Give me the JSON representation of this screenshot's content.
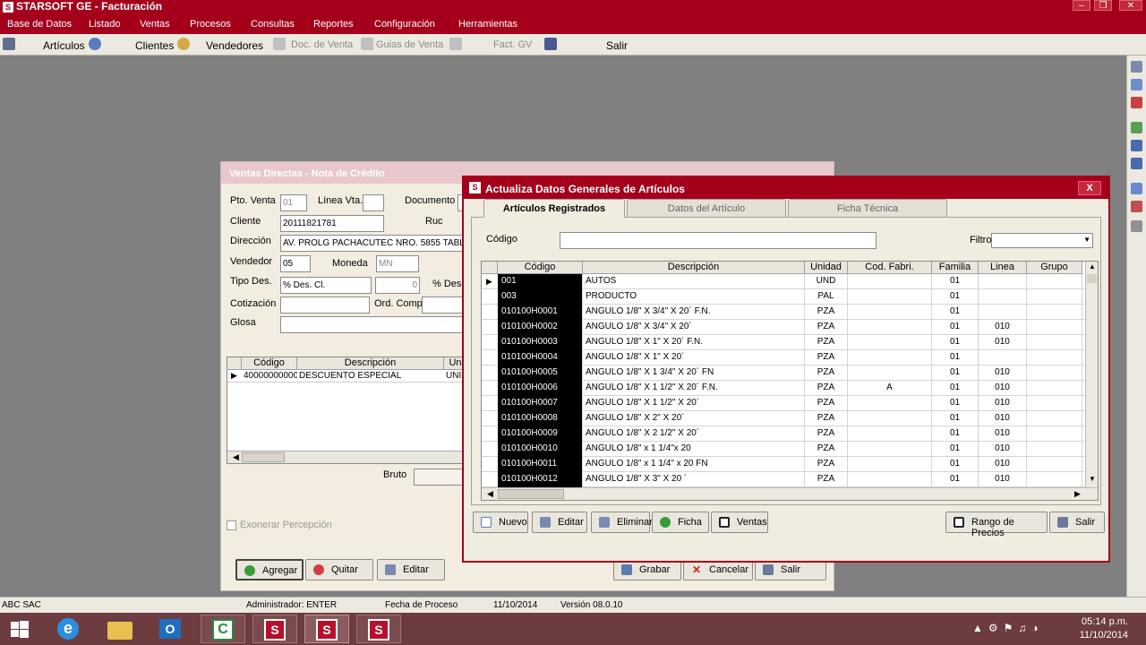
{
  "app": {
    "title": "STARSOFT GE - Facturación"
  },
  "menu": [
    "Base de Datos",
    "Listado",
    "Ventas",
    "Procesos",
    "Consultas",
    "Reportes",
    "Configuración",
    "Herramientas"
  ],
  "toolbar": {
    "articulos": "Artículos",
    "clientes": "Clientes",
    "vendedores": "Vendedores",
    "doc_venta": "Doc. de Venta",
    "guias_venta": "Guias de Venta",
    "fact_gv": "Fact. GV",
    "salir": "Salir"
  },
  "bg_window": {
    "title": "Ventas Directas - Nota de Crédito",
    "pto_venta_label": "Pto. Venta",
    "pto_venta": "01",
    "linea_vta_label": "Línea Vta.",
    "documento_label": "Documento",
    "cliente_label": "Cliente",
    "cliente": "20111821781",
    "ruc_label": "Ruc",
    "direccion_label": "Dirección",
    "direccion": "AV. PROLG PACHACUTEC NRO. 5855 TABL",
    "vendedor_label": "Vendedor",
    "vendedor": "05",
    "moneda_label": "Moneda",
    "moneda": "MN",
    "tipo_des_label": "Tipo Des.",
    "tipo_des": "% Des. Cl.",
    "tipo_des_val": "0",
    "pct_des_label": "% Des.",
    "cotizacion_label": "Cotización",
    "ord_comp_label": "Ord. Comp.",
    "glosa_label": "Glosa",
    "grid": {
      "headers": [
        "Código",
        "Descripción",
        "Un"
      ],
      "row": [
        "400000000002",
        "DESCUENTO ESPECIAL",
        "UNI"
      ]
    },
    "bruto_label": "Bruto",
    "exonerar": "Exonerar Percepción",
    "agregar": "Agregar",
    "quitar": "Quitar",
    "editar": "Editar",
    "grabar": "Grabar",
    "cancelar": "Cancelar",
    "salir": "Salir"
  },
  "modal": {
    "title": "Actualiza Datos Generales de Artículos",
    "close": "X",
    "tabs": [
      "Artículos Registrados",
      "Datos del Artículo",
      "Ficha Técnica"
    ],
    "codigo_label": "Código",
    "filtro_label": "Filtro",
    "columns": [
      "Código",
      "Descripción",
      "Unidad",
      "Cod. Fabri.",
      "Familia",
      "Linea",
      "Grupo"
    ],
    "rows": [
      [
        "001",
        "AUTOS",
        "UND",
        "",
        "01",
        "",
        ""
      ],
      [
        "003",
        "PRODUCTO",
        "PAL",
        "",
        "01",
        "",
        ""
      ],
      [
        "010100H0001",
        "ANGULO 1/8\" X 3/4\" X 20´ F.N.",
        "PZA",
        "",
        "01",
        "",
        ""
      ],
      [
        "010100H0002",
        "ANGULO 1/8\" X 3/4\" X 20´",
        "PZA",
        "",
        "01",
        "010",
        ""
      ],
      [
        "010100H0003",
        "ANGULO 1/8\" X 1\" X 20´  F.N.",
        "PZA",
        "",
        "01",
        "010",
        ""
      ],
      [
        "010100H0004",
        "ANGULO 1/8\" X 1\" X 20´",
        "PZA",
        "",
        "01",
        "",
        ""
      ],
      [
        "010100H0005",
        "ANGULO 1/8\" X 1 3/4\" X 20´ FN",
        "PZA",
        "",
        "01",
        "010",
        ""
      ],
      [
        "010100H0006",
        "ANGULO 1/8\" X 1 1/2\" X 20´ F.N.",
        "PZA",
        "A",
        "01",
        "010",
        ""
      ],
      [
        "010100H0007",
        "ANGULO 1/8\" X 1 1/2\" X 20´",
        "PZA",
        "",
        "01",
        "010",
        ""
      ],
      [
        "010100H0008",
        "ANGULO 1/8\" X 2\" X 20´",
        "PZA",
        "",
        "01",
        "010",
        ""
      ],
      [
        "010100H0009",
        "ANGULO 1/8\" X 2 1/2\" X 20´",
        "PZA",
        "",
        "01",
        "010",
        ""
      ],
      [
        "010100H0010",
        "ANGULO 1/8\" x 1 1/4\"x 20",
        "PZA",
        "",
        "01",
        "010",
        ""
      ],
      [
        "010100H0011",
        "ANGULO 1/8\" x 1 1/4\" x 20  FN",
        "PZA",
        "",
        "01",
        "010",
        ""
      ],
      [
        "010100H0012",
        "ANGULO 1/8\" X 3\" X 20 ´",
        "PZA",
        "",
        "01",
        "010",
        ""
      ]
    ],
    "buttons": {
      "nuevo": "Nuevo",
      "editar": "Editar",
      "eliminar": "Eliminar",
      "ficha": "Ficha",
      "ventas": "Ventas",
      "rango": "Rango de Precios",
      "salir": "Salir"
    }
  },
  "status": {
    "company": "ABC SAC",
    "user": "Administrador: ENTER",
    "fecha_label": "Fecha de Proceso",
    "fecha": "11/10/2014",
    "version": "Versión 08.0.10"
  },
  "clock": {
    "time": "05:14 p.m.",
    "date": "11/10/2014"
  },
  "colors": {
    "brand": "#a4001c",
    "panel": "#f0ece0"
  }
}
